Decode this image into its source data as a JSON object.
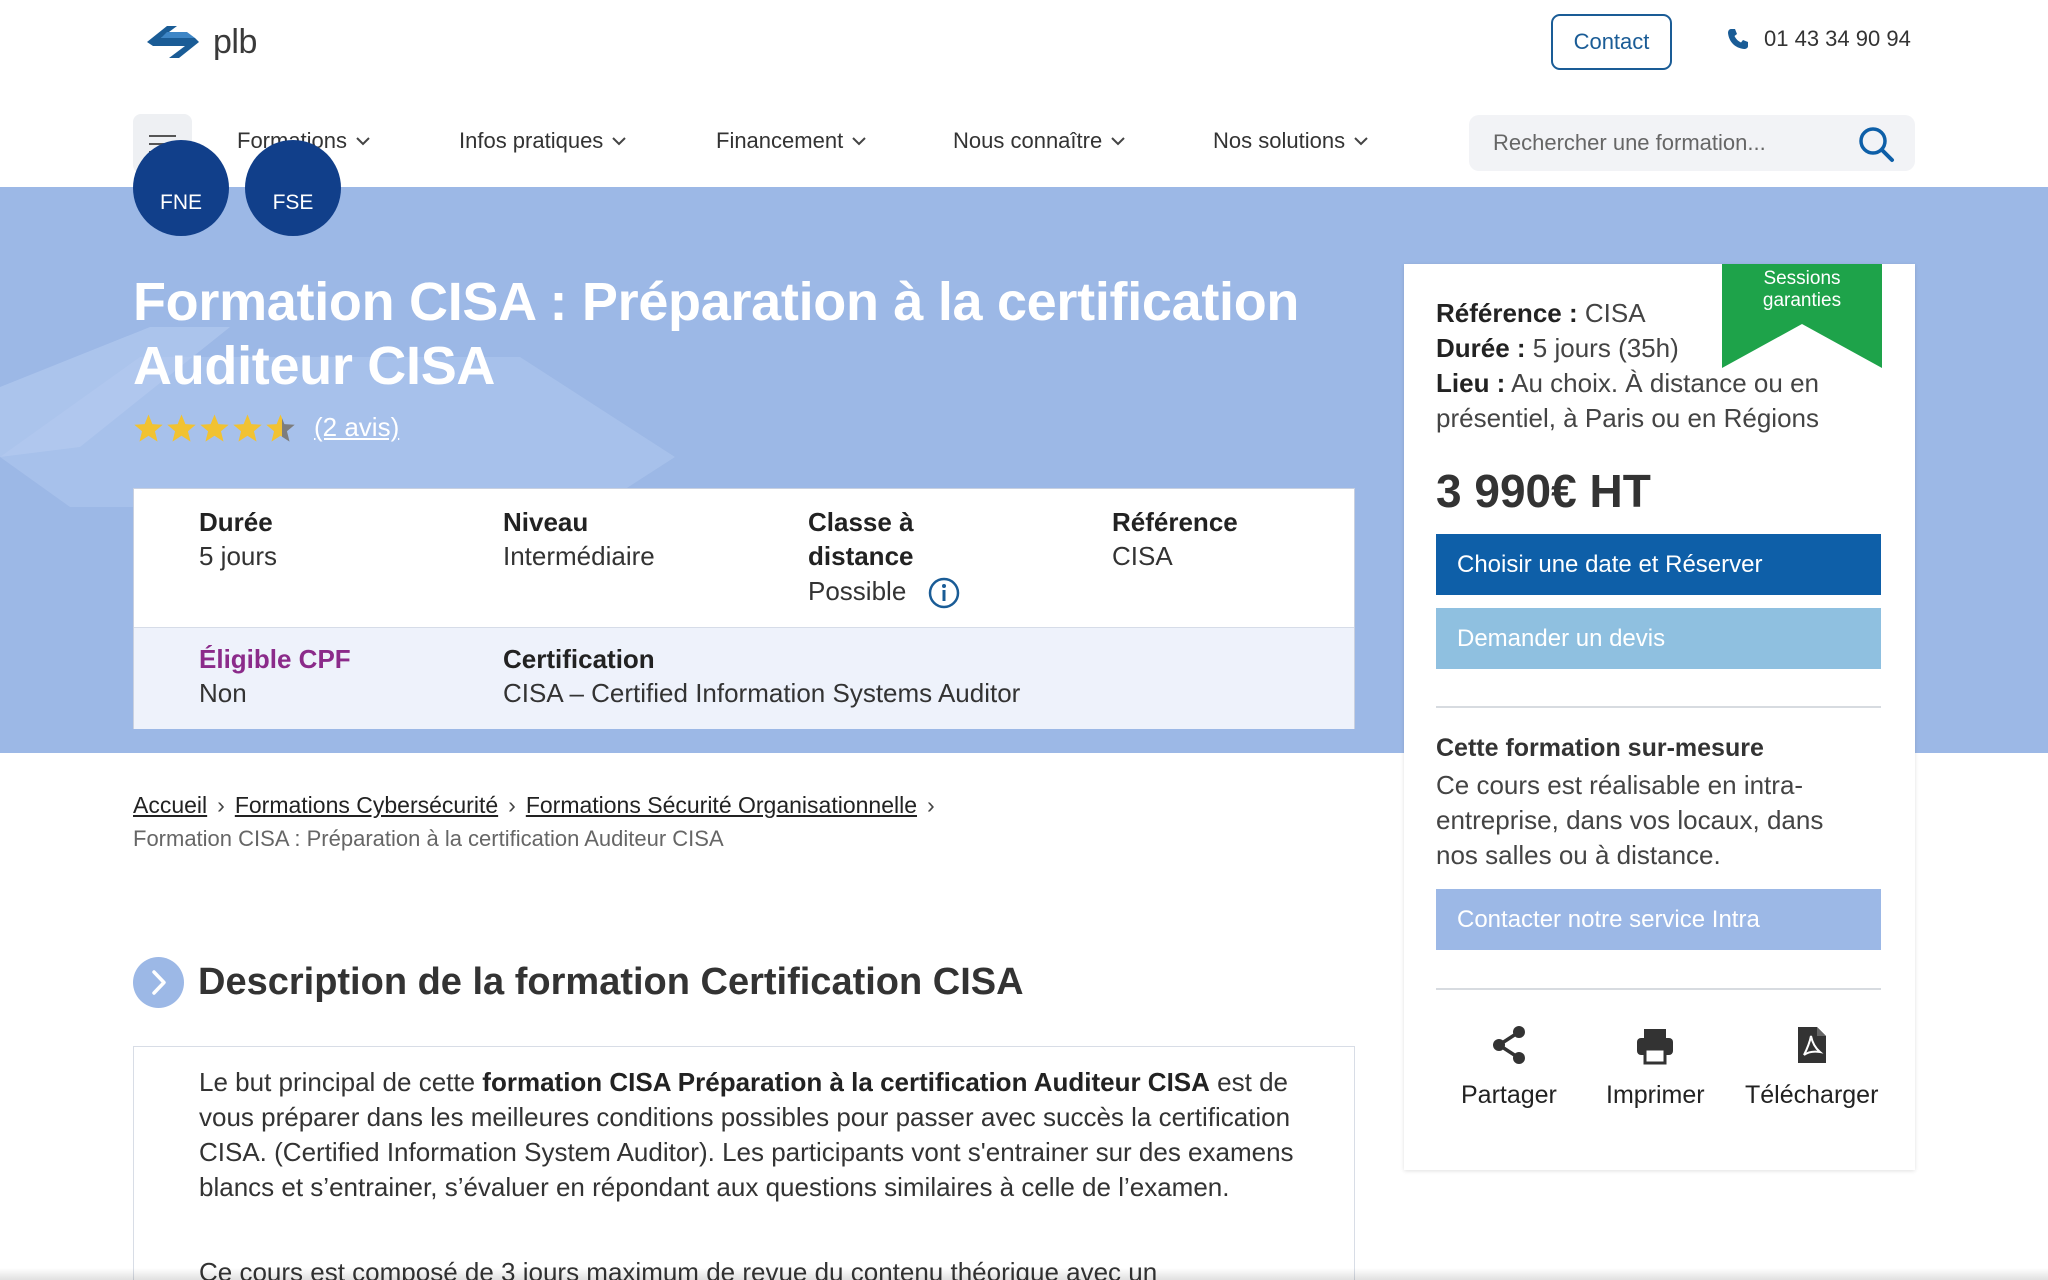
{
  "brand": {
    "name": "plb"
  },
  "header": {
    "contact_label": "Contact",
    "phone": "01 43 34 90 94"
  },
  "nav": {
    "items": [
      {
        "label": "Formations"
      },
      {
        "label": "Infos pratiques"
      },
      {
        "label": "Financement"
      },
      {
        "label": "Nous connaître"
      },
      {
        "label": "Nos solutions"
      }
    ],
    "search_placeholder": "Rechercher une formation..."
  },
  "hero": {
    "badges": [
      "FNE",
      "FSE"
    ],
    "title": "Formation CISA : Préparation à la certification Auditeur CISA",
    "rating": 4.5,
    "reviews_label": "(2 avis)"
  },
  "info": {
    "duree_label": "Durée",
    "duree_value": "5 jours",
    "niveau_label": "Niveau",
    "niveau_value": "Intermédiaire",
    "distance_label": "Classe à distance",
    "distance_value": "Possible",
    "reference_label": "Référence",
    "reference_value": "CISA",
    "cpf_label": "Éligible CPF",
    "cpf_value": "Non",
    "certification_label": "Certification",
    "certification_value": "CISA – Certified Information Systems Auditor"
  },
  "breadcrumb": {
    "items": [
      "Accueil",
      "Formations Cybersécurité",
      "Formations Sécurité Organisationnelle"
    ],
    "current": "Formation CISA : Préparation à la certification Auditeur CISA"
  },
  "description": {
    "title": "Description de la formation Certification CISA",
    "p1_before": "Le but principal de cette ",
    "p1_bold": "formation CISA Préparation à la certification Auditeur CISA",
    "p1_after": " est de vous préparer dans les meilleures conditions possibles pour passer avec succès la certification CISA. (Certified Information System Auditor). Les participants vont s'entrainer sur des examens blancs et s’entrainer, s’évaluer en répondant aux questions similaires à celle de l’examen.",
    "p2": "Ce cours est composé de 3 jours maximum de revue du contenu théorique avec un"
  },
  "sidebar": {
    "ribbon_line1": "Sessions",
    "ribbon_line2": "garanties",
    "reference_label": "Référence :",
    "reference_value": " CISA",
    "duree_label": "Durée :",
    "duree_value": " 5 jours (35h)",
    "lieu_label": "Lieu :",
    "lieu_value": " Au choix. À distance ou en présentiel, à Paris ou en Régions",
    "price": "3 990€ HT",
    "reserve_label": "Choisir une date et Réserver",
    "devis_label": "Demander un devis",
    "custom_title": "Cette formation sur-mesure",
    "custom_text": "Ce cours est réalisable en intra-entreprise, dans vos locaux, dans nos salles ou à distance.",
    "intra_label": "Contacter notre service Intra",
    "actions": [
      {
        "label": "Partager",
        "icon": "share-icon"
      },
      {
        "label": "Imprimer",
        "icon": "print-icon"
      },
      {
        "label": "Télécharger",
        "icon": "pdf-icon"
      }
    ]
  },
  "colors": {
    "hero_bg": "#9cb8e6",
    "primary": "#0e5fa8",
    "badge": "#113f8a",
    "ribbon": "#1ea34a",
    "cpf": "#8b2b8a"
  }
}
